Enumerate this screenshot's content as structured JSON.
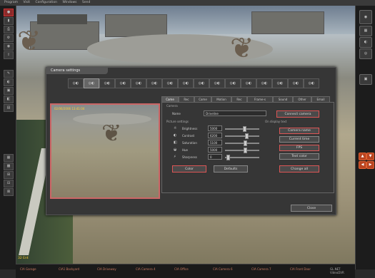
{
  "menubar": {
    "items": [
      "Program",
      "Visit",
      "Configuration",
      "Windows",
      "Send"
    ]
  },
  "left_toolbar": {
    "buttons": [
      "●",
      "▮",
      "⎙",
      "⚙",
      "◉",
      "⇧",
      "✎",
      "◐",
      "▣",
      "◧",
      "▤",
      "▦",
      "▩",
      "⊞",
      "⊟",
      "⊠"
    ]
  },
  "right_toolbar": {
    "buttons": [
      "◉",
      "▦",
      "◐",
      "◎",
      "▣",
      "▲",
      "▼",
      "◀",
      "▶"
    ]
  },
  "status_bar": {
    "camera_label": "32 Ent",
    "cells": [
      "CIA Garage",
      "CIA1 Backyard",
      "CIA Driveway",
      "CIA Camera 4",
      "CIA Office",
      "CIA Camera 6",
      "CIA Camera 7",
      "CIA Front Door"
    ],
    "right_text": "GL.NET VideoDVR"
  },
  "dialog": {
    "title": "Camera settings",
    "camera_icons": [
      "◎◐",
      "◎◐",
      "◎◐",
      "◎◐",
      "◎◐",
      "◎◐",
      "◎◐",
      "◎◐",
      "◎◐",
      "◎◐",
      "◎◐",
      "◎◐",
      "◎◐",
      "◎◐",
      "◎◐",
      "◎◐"
    ],
    "preview_label": "02/06/2006 13:41:04",
    "tabs": [
      "Came",
      "Rec",
      "Came",
      "Motion",
      "Rec",
      "Frame-s",
      "Sound",
      "Other",
      "Email"
    ],
    "camera_group": "Camera",
    "name_label": "Name",
    "name_value": "Driveline",
    "connect_button": "Connect camera",
    "picture_group": "Picture settings",
    "onscreen_group": "On display text",
    "settings": [
      {
        "label": "Brightness",
        "value": "5000",
        "level": 0.52
      },
      {
        "label": "Contrast",
        "value": "6200",
        "level": 0.58
      },
      {
        "label": "Saturation",
        "value": "5100",
        "level": 0.55
      },
      {
        "label": "Hue",
        "value": "5000",
        "level": 0.54
      },
      {
        "label": "Sharpness",
        "value": "0",
        "level": 0.05
      }
    ],
    "camera_name_button": "Camera name",
    "current_time_button": "Current time",
    "fps_button": "FPS",
    "text_color_button": "Text color",
    "color_button": "Color",
    "defaults_button": "Defaults",
    "change_all_button": "Change all",
    "close_button": "Close"
  },
  "colors": {
    "accent": "#c66666",
    "highlight": "#b84420",
    "label_yellow": "#ffcc33"
  }
}
